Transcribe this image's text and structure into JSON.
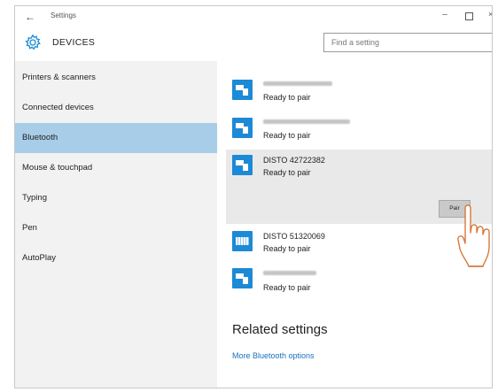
{
  "window": {
    "title": "Settings",
    "back_glyph": "←",
    "minimize_glyph": "–",
    "close_glyph": "×"
  },
  "header": {
    "page_title": "DEVICES",
    "search_placeholder": "Find a setting"
  },
  "sidebar": {
    "items": [
      {
        "label": "Printers & scanners"
      },
      {
        "label": "Connected devices"
      },
      {
        "label": "Bluetooth",
        "active": true
      },
      {
        "label": "Mouse & touchpad"
      },
      {
        "label": "Typing"
      },
      {
        "label": "Pen"
      },
      {
        "label": "AutoPlay"
      }
    ]
  },
  "devices": [
    {
      "name": "",
      "status": "Ready to pair"
    },
    {
      "name": "",
      "status": "Ready to pair"
    },
    {
      "name": "DISTO 42722382",
      "status": "Ready to pair",
      "selected": true
    },
    {
      "name": "DISTO 51320069",
      "status": "Ready to pair"
    },
    {
      "name": "",
      "status": "Ready to pair"
    }
  ],
  "pair_button": "Pair",
  "related": {
    "title": "Related settings",
    "link": "More Bluetooth options"
  },
  "colors": {
    "accent": "#1c8ad6",
    "sidebar_active": "#a8cde9",
    "link": "#1a6fc1"
  }
}
